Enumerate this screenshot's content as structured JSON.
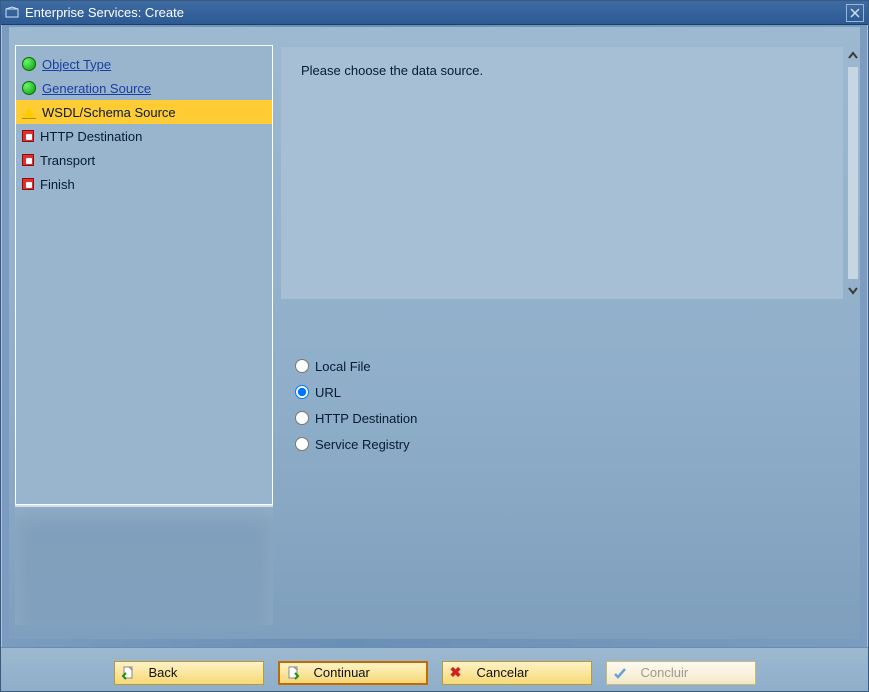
{
  "window": {
    "title": "Enterprise Services: Create"
  },
  "sidebar": {
    "steps": [
      {
        "id": "object-type",
        "label": "Object Type",
        "status": "green",
        "link": true,
        "selected": false
      },
      {
        "id": "generation-source",
        "label": "Generation Source",
        "status": "green",
        "link": true,
        "selected": false
      },
      {
        "id": "wsdl-schema-source",
        "label": "WSDL/Schema Source",
        "status": "yellow",
        "link": false,
        "selected": true
      },
      {
        "id": "http-destination",
        "label": "HTTP Destination",
        "status": "red",
        "link": false,
        "selected": false
      },
      {
        "id": "transport",
        "label": "Transport",
        "status": "red",
        "link": false,
        "selected": false
      },
      {
        "id": "finish",
        "label": "Finish",
        "status": "red",
        "link": false,
        "selected": false
      }
    ]
  },
  "panel": {
    "instruction": "Please choose the data source."
  },
  "radios": {
    "name": "data-source",
    "options": [
      {
        "id": "local-file",
        "label": "Local File",
        "checked": false
      },
      {
        "id": "url",
        "label": "URL",
        "checked": true
      },
      {
        "id": "http-destination",
        "label": "HTTP Destination",
        "checked": false
      },
      {
        "id": "service-registry",
        "label": "Service Registry",
        "checked": false
      }
    ]
  },
  "footer": {
    "back": "Back",
    "continue": "Continuar",
    "cancel": "Cancelar",
    "finish": "Concluir"
  }
}
